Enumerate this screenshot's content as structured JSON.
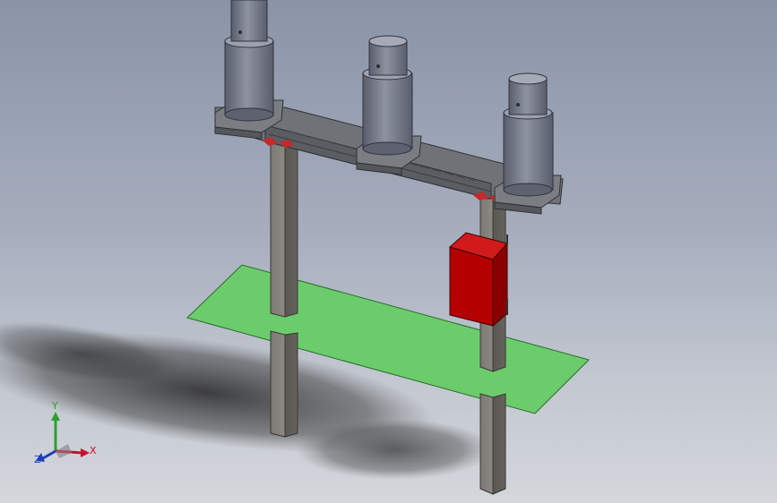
{
  "triad": {
    "x_label": "X",
    "y_label": "Y",
    "z_label": "Z",
    "x_color": "#c8102e",
    "y_color": "#2e9e2e",
    "z_color": "#1f3fb8"
  },
  "model": {
    "ground_plate_color": "#6bcc6b",
    "post_color": "#6e6b66",
    "insulator_color": "#6b6f7a",
    "beam_color": "#6f7276",
    "control_box_color": "#b40000"
  }
}
